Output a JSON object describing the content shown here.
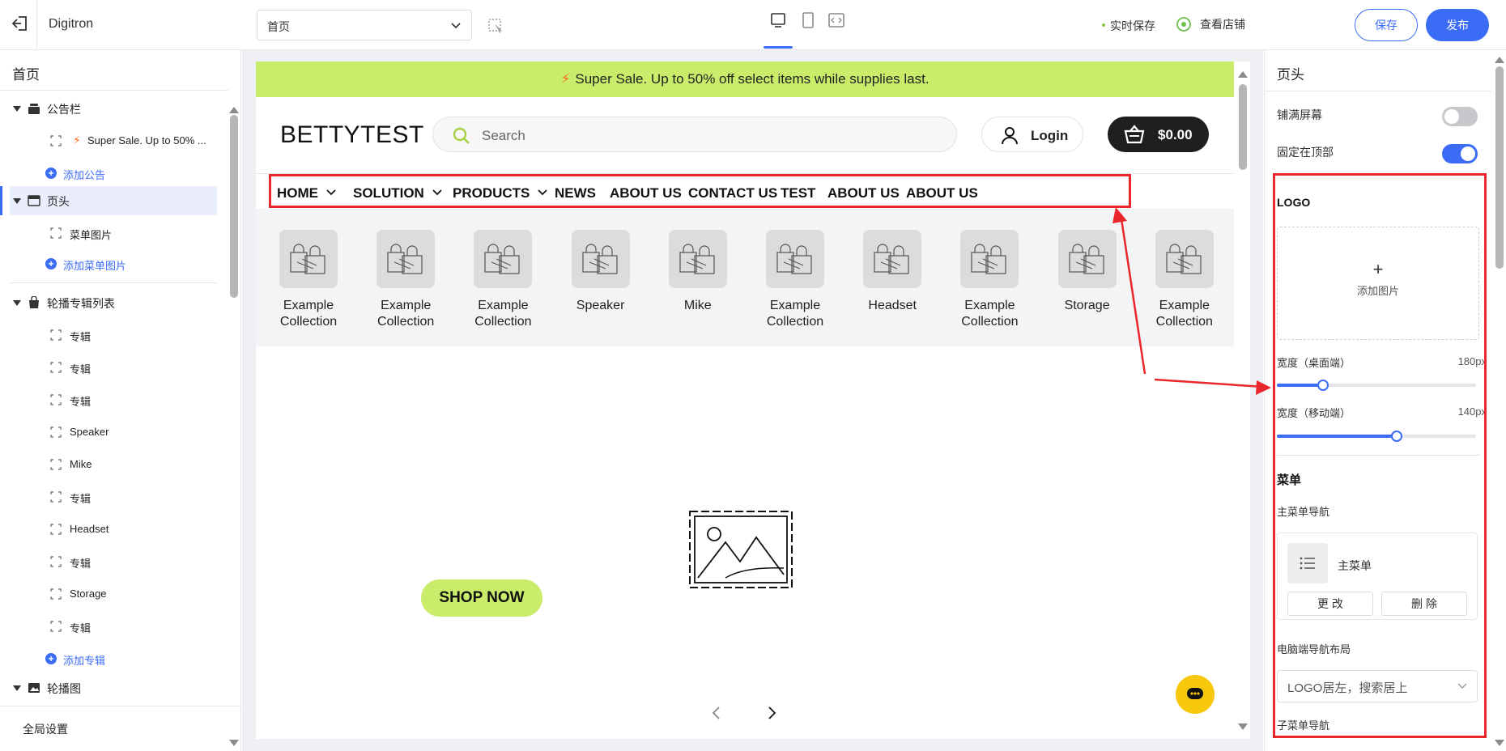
{
  "topbar": {
    "app_name": "Digitron",
    "page_select_value": "首页",
    "autosave": "实时保存",
    "view_store": "查看店铺",
    "save_label": "保存",
    "publish_label": "发布"
  },
  "sidebar": {
    "title": "首页",
    "groups": [
      {
        "label": "公告栏",
        "items": [
          "Super Sale. Up to 50% ..."
        ],
        "add_label": "添加公告"
      },
      {
        "label": "页头",
        "items": [
          "菜单图片"
        ],
        "add_label": "添加菜单图片"
      },
      {
        "label": "轮播专辑列表",
        "items": [
          "专辑",
          "专辑",
          "专辑",
          "Speaker",
          "Mike",
          "专辑",
          "Headset",
          "专辑",
          "Storage",
          "专辑"
        ],
        "add_label": "添加专辑"
      },
      {
        "label": "轮播图"
      }
    ],
    "global_settings": "全局设置"
  },
  "preview": {
    "announcement": "Super Sale. Up to 50% off select items while supplies last.",
    "logo": "BETTYTEST",
    "search_placeholder": "Search",
    "login_label": "Login",
    "cart_label": "$0.00",
    "nav": [
      "HOME",
      "SOLUTION",
      "PRODUCTS",
      "NEWS",
      "ABOUT US",
      "CONTACT US",
      "TEST",
      "ABOUT US",
      "ABOUT US"
    ],
    "collections": [
      {
        "line1": "Example",
        "line2": "Collection"
      },
      {
        "line1": "Example",
        "line2": "Collection"
      },
      {
        "line1": "Example",
        "line2": "Collection"
      },
      {
        "line1": "Speaker",
        "line2": ""
      },
      {
        "line1": "Mike",
        "line2": ""
      },
      {
        "line1": "Example",
        "line2": "Collection"
      },
      {
        "line1": "Headset",
        "line2": ""
      },
      {
        "line1": "Example",
        "line2": "Collection"
      },
      {
        "line1": "Storage",
        "line2": ""
      },
      {
        "line1": "Example",
        "line2": "Collection"
      }
    ],
    "shop_now": "SHOP NOW"
  },
  "rpanel": {
    "title": "页头",
    "full_screen_label": "铺满屏幕",
    "full_screen_on": false,
    "sticky_top_label": "固定在顶部",
    "sticky_top_on": true,
    "logo_section": "LOGO",
    "add_image": "添加图片",
    "width_desktop_label": "宽度（桌面端）",
    "width_desktop_value": "180px",
    "width_desktop_fraction": 0.23,
    "width_mobile_label": "宽度（移动端）",
    "width_mobile_value": "140px",
    "width_mobile_fraction": 0.6,
    "menu_section": "菜单",
    "main_menu_nav_label": "主菜单导航",
    "main_menu_name": "主菜单",
    "change_label": "更 改",
    "delete_label": "删 除",
    "desktop_layout_label": "电脑端导航布局",
    "desktop_layout_value": "LOGO居左，搜索居上",
    "submenu_nav_label": "子菜单导航"
  },
  "colors": {
    "accent": "#3b6cf6",
    "announcement_bg": "#c9ec6a",
    "annotation_red": "#e8262b",
    "chat_yellow": "#f7c70b"
  }
}
